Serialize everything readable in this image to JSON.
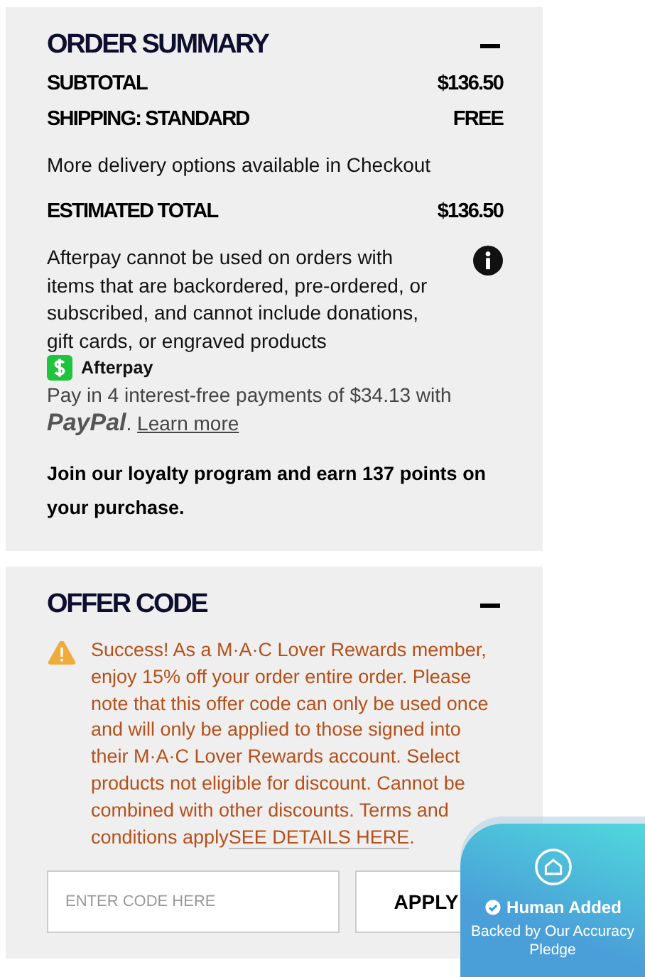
{
  "order_summary": {
    "title": "ORDER SUMMARY",
    "expanded": true,
    "rows": [
      {
        "label": "SUBTOTAL",
        "value": "$136.50"
      },
      {
        "label": "SHIPPING: STANDARD",
        "value": "FREE"
      }
    ],
    "delivery_note": "More delivery options available in Checkout",
    "total": {
      "label": "ESTIMATED TOTAL",
      "value": "$136.50"
    },
    "afterpay_notice": "Afterpay cannot be used on orders with items that are backordered, pre-ordered, or subscribed, and cannot include donations, gift cards, or engraved products",
    "afterpay_label": "Afterpay",
    "paypal_text": "Pay in 4 interest-free payments of $34.13 with",
    "paypal_brand": "PayPal",
    "paypal_dot": ".",
    "learn_more": "Learn more",
    "loyalty": "Join our loyalty program and earn 137 points on your purchase."
  },
  "offer_code": {
    "title": "OFFER CODE",
    "expanded": true,
    "message": "Success! As a M·A·C Lover Rewards member, enjoy 15% off your order entire order. Please note that this offer code can only be used once and will only be applied to those signed into their M·A·C Lover Rewards account. Select products not eligible for discount. Cannot be combined with other discounts. Terms and conditions apply",
    "details_link": "SEE DETAILS HERE",
    "details_end": ".",
    "placeholder": "ENTER CODE HERE",
    "apply": "APPLY"
  },
  "badge": {
    "title": "Human Added",
    "subtitle": "Backed by Our Accuracy Pledge"
  }
}
